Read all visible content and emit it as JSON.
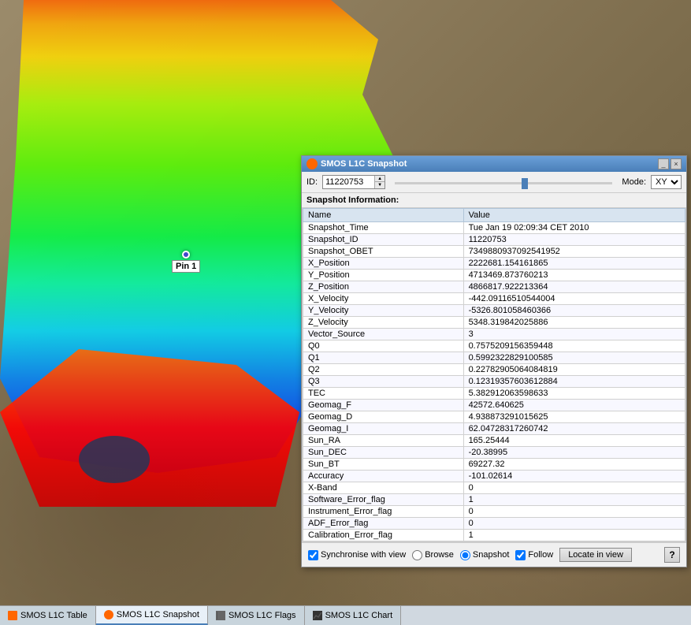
{
  "dialog": {
    "title": "SMOS L1C Snapshot",
    "id_label": "ID:",
    "id_value": "11220753",
    "mode_label": "Mode:",
    "mode_value": "XY",
    "snapshot_info_label": "Snapshot Information:",
    "table_headers": [
      "Name",
      "Value"
    ],
    "table_rows": [
      [
        "Snapshot_Time",
        "Tue Jan 19 02:09:34 CET 2010"
      ],
      [
        "Snapshot_ID",
        "11220753"
      ],
      [
        "Snapshot_OBET",
        "7349880937092541952"
      ],
      [
        "X_Position",
        "2222681.154161865"
      ],
      [
        "Y_Position",
        "4713469.873760213"
      ],
      [
        "Z_Position",
        "4866817.922213364"
      ],
      [
        "X_Velocity",
        "-442.09116510544004"
      ],
      [
        "Y_Velocity",
        "-5326.801058460366"
      ],
      [
        "Z_Velocity",
        "5348.319842025886"
      ],
      [
        "Vector_Source",
        "3"
      ],
      [
        "Q0",
        "0.7575209156359448"
      ],
      [
        "Q1",
        "0.5992322829100585"
      ],
      [
        "Q2",
        "0.22782905064084819"
      ],
      [
        "Q3",
        "0.12319357603612884"
      ],
      [
        "TEC",
        "5.382912063598633"
      ],
      [
        "Geomag_F",
        "42572.640625"
      ],
      [
        "Geomag_D",
        "4.938873291015625"
      ],
      [
        "Geomag_I",
        "62.04728317260742"
      ],
      [
        "Sun_RA",
        "165.25444"
      ],
      [
        "Sun_DEC",
        "-20.38995"
      ],
      [
        "Sun_BT",
        "69227.32"
      ],
      [
        "Accuracy",
        "-101.02614"
      ],
      [
        "X-Band",
        "0"
      ],
      [
        "Software_Error_flag",
        "1"
      ],
      [
        "Instrument_Error_flag",
        "0"
      ],
      [
        "ADF_Error_flag",
        "0"
      ],
      [
        "Calibration_Error_flag",
        "1"
      ]
    ],
    "toolbar": {
      "synchronise_label": "Synchronise with view",
      "browse_label": "Browse",
      "snapshot_label": "Snapshot",
      "follow_label": "Follow",
      "locate_label": "Locate in view",
      "help_label": "?"
    }
  },
  "pin": {
    "label": "Pin 1"
  },
  "tabs": [
    {
      "label": "SMOS L1C Table",
      "icon": "table-icon",
      "active": false
    },
    {
      "label": "SMOS L1C Snapshot",
      "icon": "snapshot-icon",
      "active": true
    },
    {
      "label": "SMOS L1C Flags",
      "icon": "flags-icon",
      "active": false
    },
    {
      "label": "SMOS L1C Chart",
      "icon": "chart-icon",
      "active": false
    }
  ]
}
